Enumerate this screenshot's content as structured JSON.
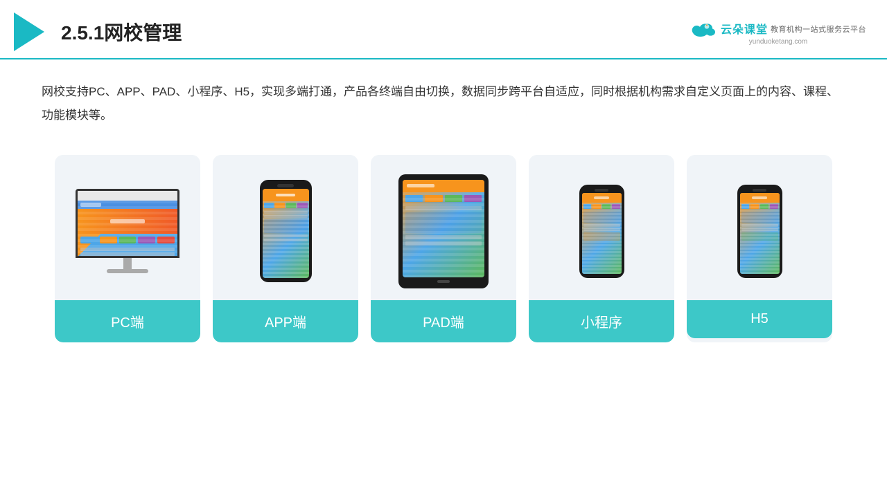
{
  "header": {
    "title": "2.5.1网校管理",
    "logo": {
      "name": "云朵课堂",
      "url": "yunduoketang.com",
      "subtitle": "教育机构一站式服务云平台"
    }
  },
  "description": {
    "text": "网校支持PC、APP、PAD、小程序、H5，实现多端打通，产品各终端自由切换，数据同步跨平台自适应，同时根据机构需求自定义页面上的内容、课程、功能模块等。"
  },
  "cards": [
    {
      "id": "pc",
      "label": "PC端"
    },
    {
      "id": "app",
      "label": "APP端"
    },
    {
      "id": "pad",
      "label": "PAD端"
    },
    {
      "id": "miniapp",
      "label": "小程序"
    },
    {
      "id": "h5",
      "label": "H5"
    }
  ]
}
